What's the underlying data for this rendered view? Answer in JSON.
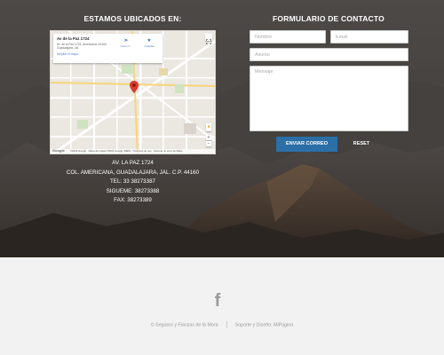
{
  "location": {
    "title": "ESTAMOS UBICADOS EN:",
    "map": {
      "place_name": "Av de la Paz 1724",
      "place_address": "Av. de la Paz 1724, Americana, 44160 Guadalajara, Jal.",
      "enlarge_link": "Ampliar el mapa",
      "directions_label": "Cómo ll...",
      "save_label": "Guardar",
      "directions_icon": "directions-icon",
      "save_icon": "star-icon",
      "zoom_in": "+",
      "zoom_out": "−",
      "logo": "Google",
      "footer_text": "©2016 Google · Datos del mapa ©2016 Google, INEGI · Términos de uso · Informar un error de Maps",
      "pin_color": "#d93b2b",
      "streets": [
        "Calle Francisco Javier",
        "Av. de la Paz",
        "Calle José Guadalupe Zuno",
        "Av. Chapultepec",
        "Calle López Cotilla"
      ],
      "pois": [
        "Parque Revolución",
        "Expiatorio",
        "Teatro Diana"
      ]
    },
    "address_lines": [
      "AV. LA PAZ 1724",
      "COL. AMERICANA, GUADALAJARA, JAL. C.P. 44160",
      "TEL: 33 38273387",
      "SIGUEME: 38273388",
      "FAX: 38273389"
    ]
  },
  "contact": {
    "title": "FORMULARIO DE CONTACTO",
    "name_placeholder": "Nombre",
    "email_placeholder": "Email",
    "subject_placeholder": "Asunto",
    "message_placeholder": "Mensaje",
    "send_label": "ENVIAR CORREO",
    "reset_label": "RESET",
    "send_color": "#2b6fa6"
  },
  "footer": {
    "social_icon": "facebook-icon",
    "social_glyph": "f",
    "credit_left": "© Seguros y Fianzas de la Mora",
    "credit_right": "Soporte y Diseño: MiPagina"
  }
}
